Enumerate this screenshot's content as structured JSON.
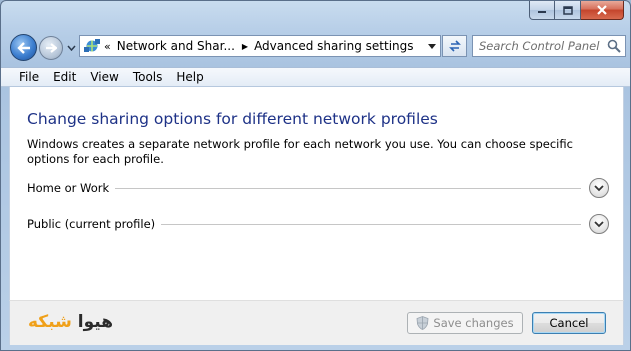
{
  "window": {
    "caption_buttons": [
      "minimize",
      "maximize",
      "close"
    ]
  },
  "nav": {
    "address": {
      "overflow": "«",
      "crumbs": [
        "Network and Shar...",
        "Advanced sharing settings"
      ]
    },
    "search": {
      "placeholder": "Search Control Panel"
    }
  },
  "menubar": {
    "items": [
      "File",
      "Edit",
      "View",
      "Tools",
      "Help"
    ]
  },
  "main": {
    "heading": "Change sharing options for different network profiles",
    "description": "Windows creates a separate network profile for each network you use. You can choose specific options for each profile.",
    "profiles": [
      {
        "label": "Home or Work"
      },
      {
        "label": "Public (current profile)"
      }
    ]
  },
  "footer": {
    "watermark": {
      "part1": "هیوا",
      "part2": "شبکه"
    },
    "save_label": "Save changes",
    "cancel_label": "Cancel"
  },
  "colors": {
    "heading": "#1e3287",
    "watermark_accent": "#f0a019",
    "window_frame": "#b8cfe8"
  }
}
